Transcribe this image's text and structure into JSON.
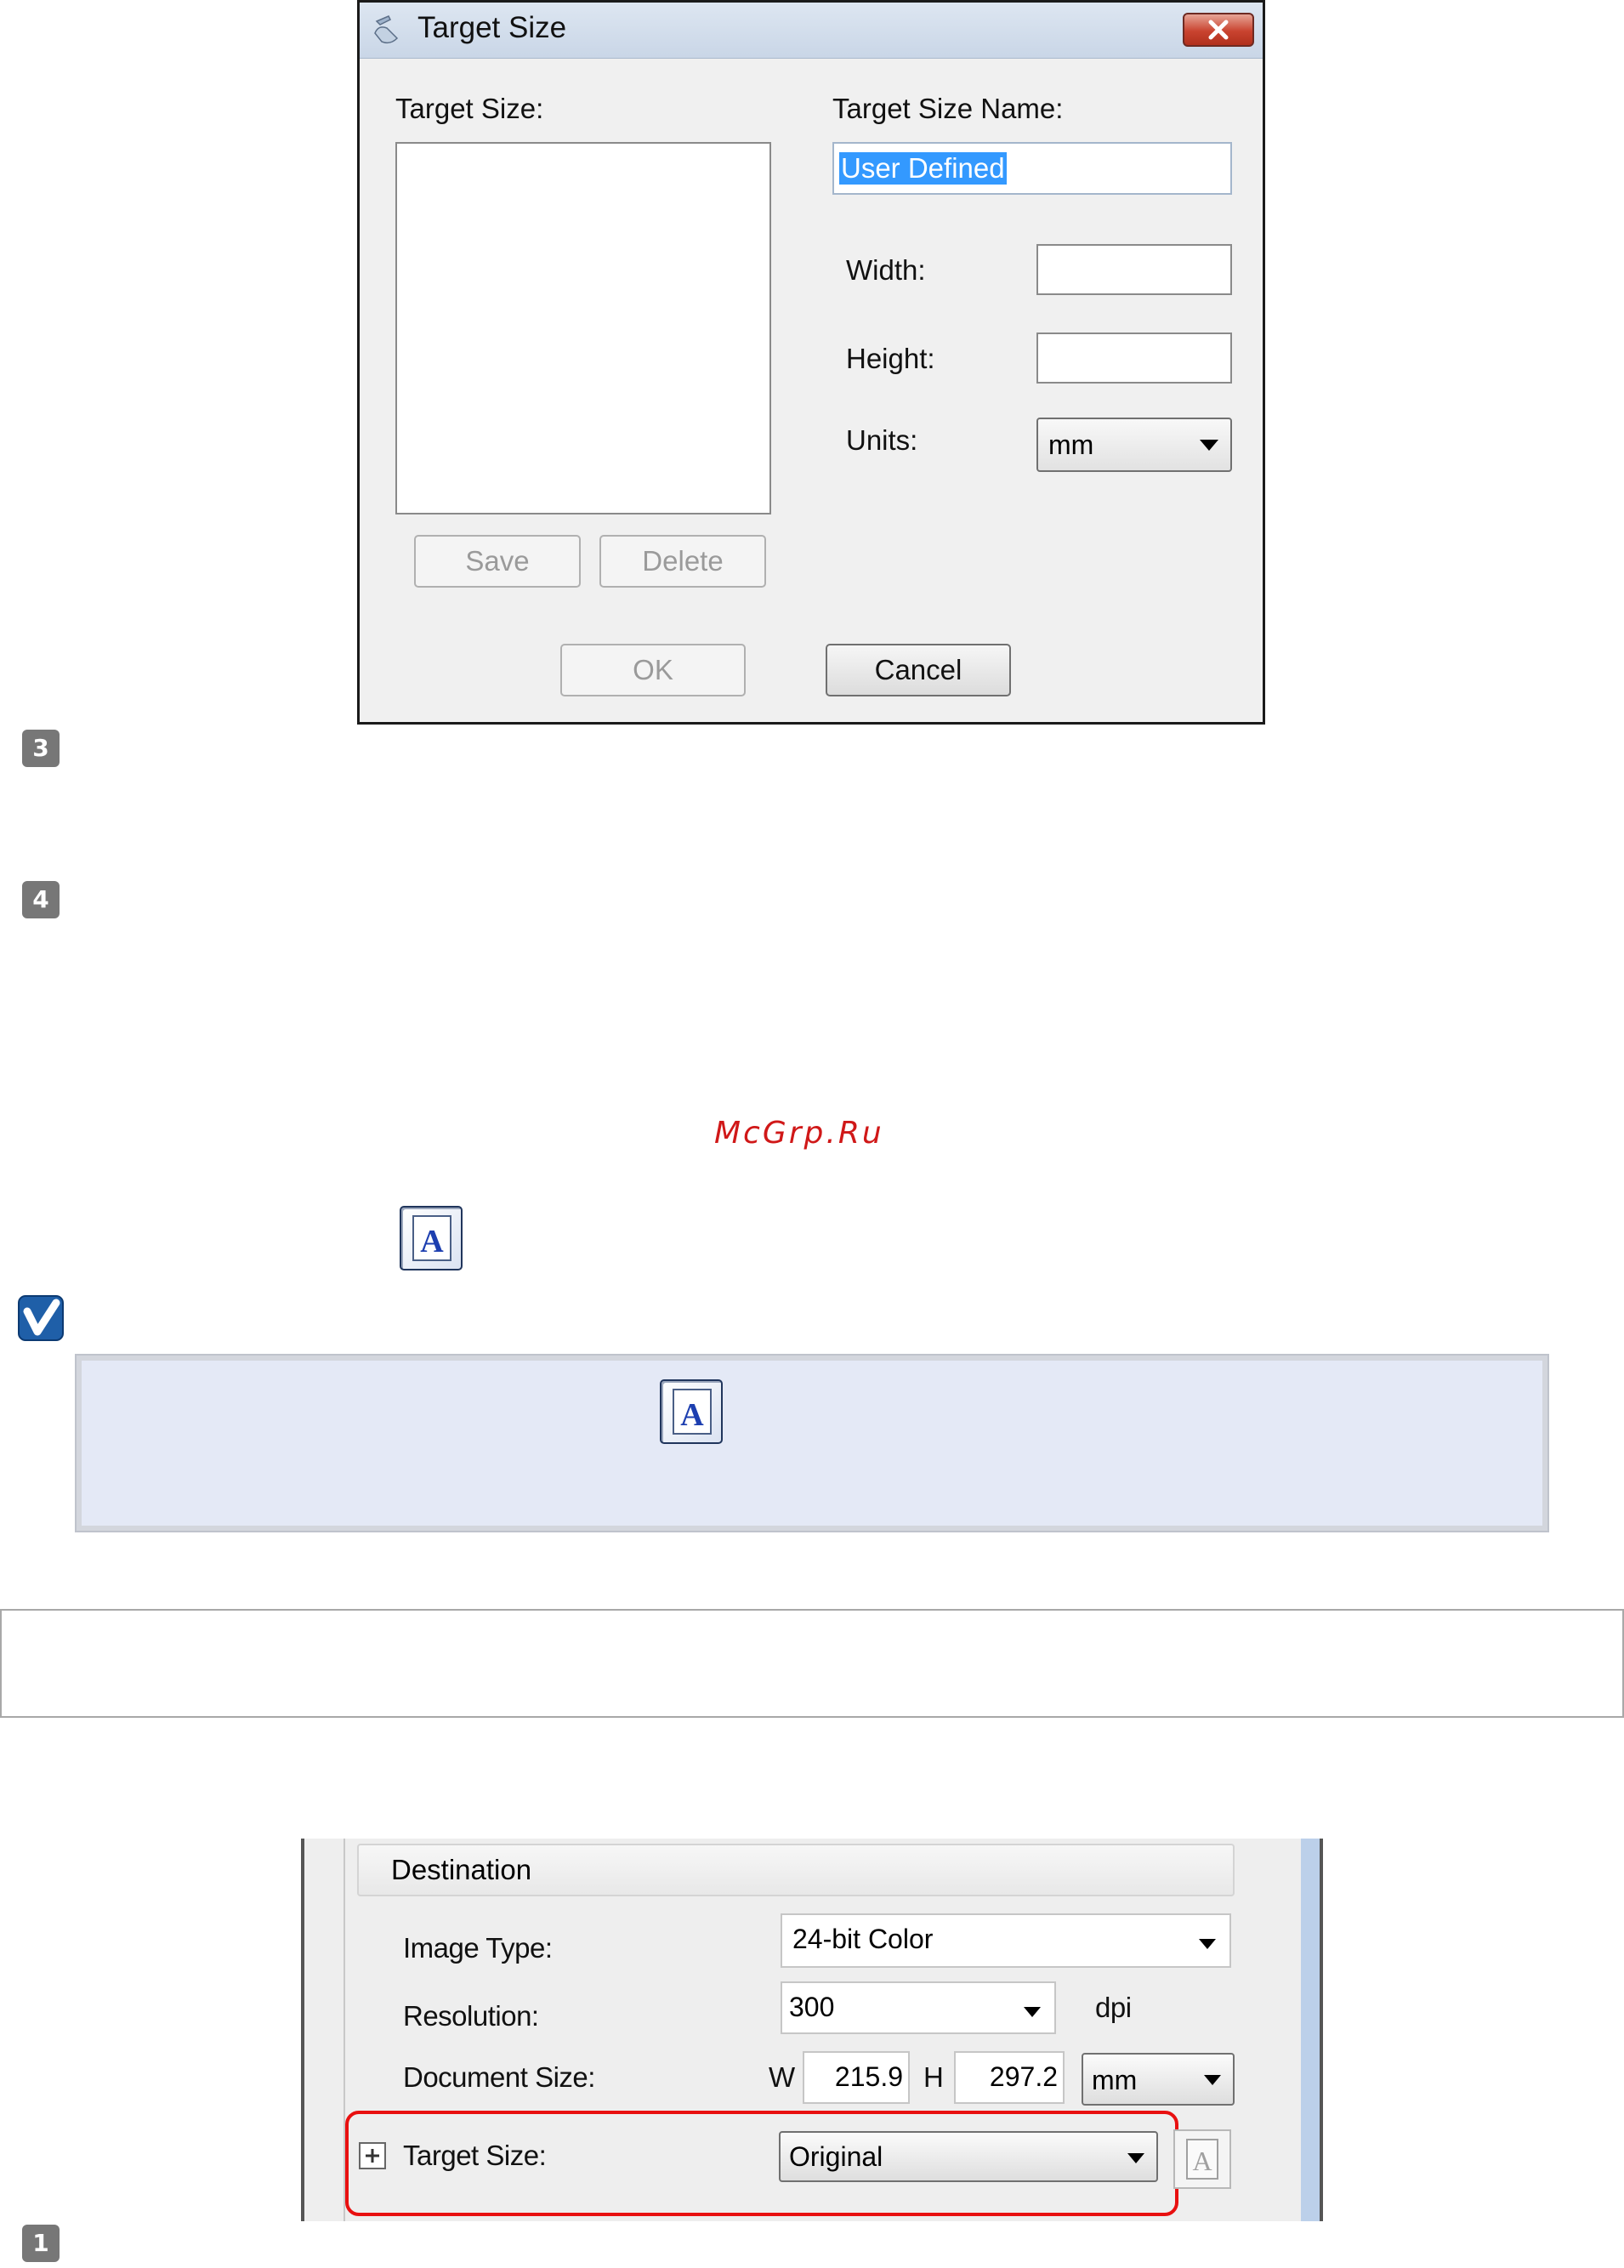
{
  "target_size_dialog": {
    "title": "Target Size",
    "target_size_label": "Target Size:",
    "target_size_name_label": "Target Size Name:",
    "target_size_name_value": "User Defined",
    "width_label": "Width:",
    "height_label": "Height:",
    "units_label": "Units:",
    "units_value": "mm",
    "save_label": "Save",
    "delete_label": "Delete",
    "ok_label": "OK",
    "cancel_label": "Cancel"
  },
  "steps": {
    "step3": "3",
    "step4": "4",
    "step1": "1"
  },
  "watermark": "McGrp.Ru",
  "destination_panel": {
    "section_title": "Destination",
    "image_type_label": "Image Type:",
    "image_type_value": "24-bit Color",
    "resolution_label": "Resolution:",
    "resolution_value": "300",
    "resolution_unit": "dpi",
    "document_size_label": "Document Size:",
    "width_prefix": "W",
    "width_value": "215.9",
    "height_prefix": "H",
    "height_value": "297.2",
    "units_value": "mm",
    "target_size_label": "Target Size:",
    "target_size_value": "Original"
  },
  "icons": {
    "app": "scanner-icon",
    "close": "close-icon",
    "ratio": "text-orientation-icon",
    "note": "checkmark-note-icon"
  },
  "colors": {
    "highlight": "#e81010",
    "selection": "#3399ff",
    "note_bg": "#e4e9f6"
  }
}
